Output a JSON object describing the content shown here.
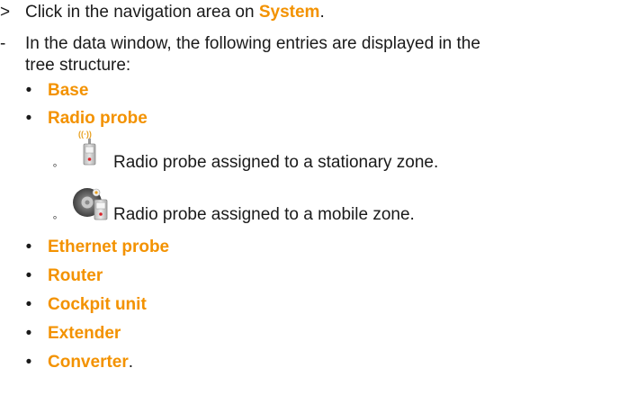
{
  "instruction": {
    "marker": ">",
    "prefix": "Click in the navigation area on ",
    "link": "System",
    "suffix": "."
  },
  "result": {
    "marker": "-",
    "line1": "In the data window, the following entries are displayed in the",
    "line2": "tree structure:"
  },
  "entries": [
    {
      "label": "Base",
      "suffix": ""
    },
    {
      "label": "Radio probe",
      "suffix": ""
    },
    {
      "label": "Ethernet probe",
      "suffix": ""
    },
    {
      "label": "Router",
      "suffix": ""
    },
    {
      "label": "Cockpit unit",
      "suffix": ""
    },
    {
      "label": "Extender",
      "suffix": ""
    },
    {
      "label": "Converter",
      "suffix": "."
    }
  ],
  "sub_entries": [
    {
      "text": "Radio probe assigned to a stationary zone.",
      "icon": "radio-probe-stationary-icon"
    },
    {
      "text": "Radio probe assigned to a mobile zone.",
      "icon": "radio-probe-mobile-icon"
    }
  ],
  "markers": {
    "bullet": "•",
    "sub_bullet": "◦",
    "signal": "((⋅))"
  },
  "colors": {
    "highlight": "#f39200",
    "text": "#1a1a1a"
  }
}
